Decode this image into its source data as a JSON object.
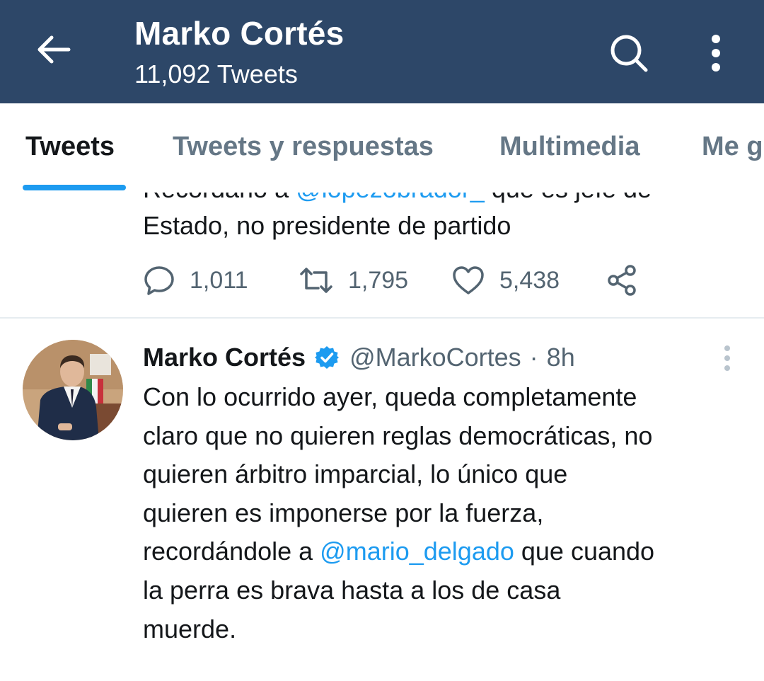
{
  "header": {
    "title": "Marko Cortés",
    "subtitle": "11,092 Tweets",
    "colors": {
      "bar": "#2d4768",
      "text": "#ffffff"
    }
  },
  "tabs": [
    {
      "label": "Tweets",
      "active": true
    },
    {
      "label": "Tweets y respuestas",
      "active": false
    },
    {
      "label": "Multimedia",
      "active": false
    },
    {
      "label": "Me g",
      "active": false
    }
  ],
  "tweet1": {
    "clipped_line": {
      "before": "Recordarlo a ",
      "mention": "@lopezobrador_",
      "after": " que es jefe de"
    },
    "text_line": "Estado, no presidente de partido",
    "replies": "1,011",
    "retweets": "1,795",
    "likes": "5,438",
    "icons": [
      "reply-icon",
      "retweet-icon",
      "like-icon",
      "share-icon"
    ]
  },
  "tweet2": {
    "name": "Marko Cortés",
    "handle": "@MarkoCortes",
    "separator": "·",
    "time": "8h",
    "lines": [
      "Con lo ocurrido ayer, queda completamente",
      "claro que no quieren reglas democráticas, no",
      "quieren árbitro imparcial, lo único que",
      "quieren es imponerse por la fuerza,"
    ],
    "mention_line": {
      "before": "recordándole a ",
      "mention": "@mario_delgado",
      "after": " que cuando"
    },
    "lines_after": [
      "la perra es brava hasta a los de casa",
      "muerde."
    ],
    "colors": {
      "accent": "#1d9bf0",
      "secondary": "#536471"
    }
  }
}
